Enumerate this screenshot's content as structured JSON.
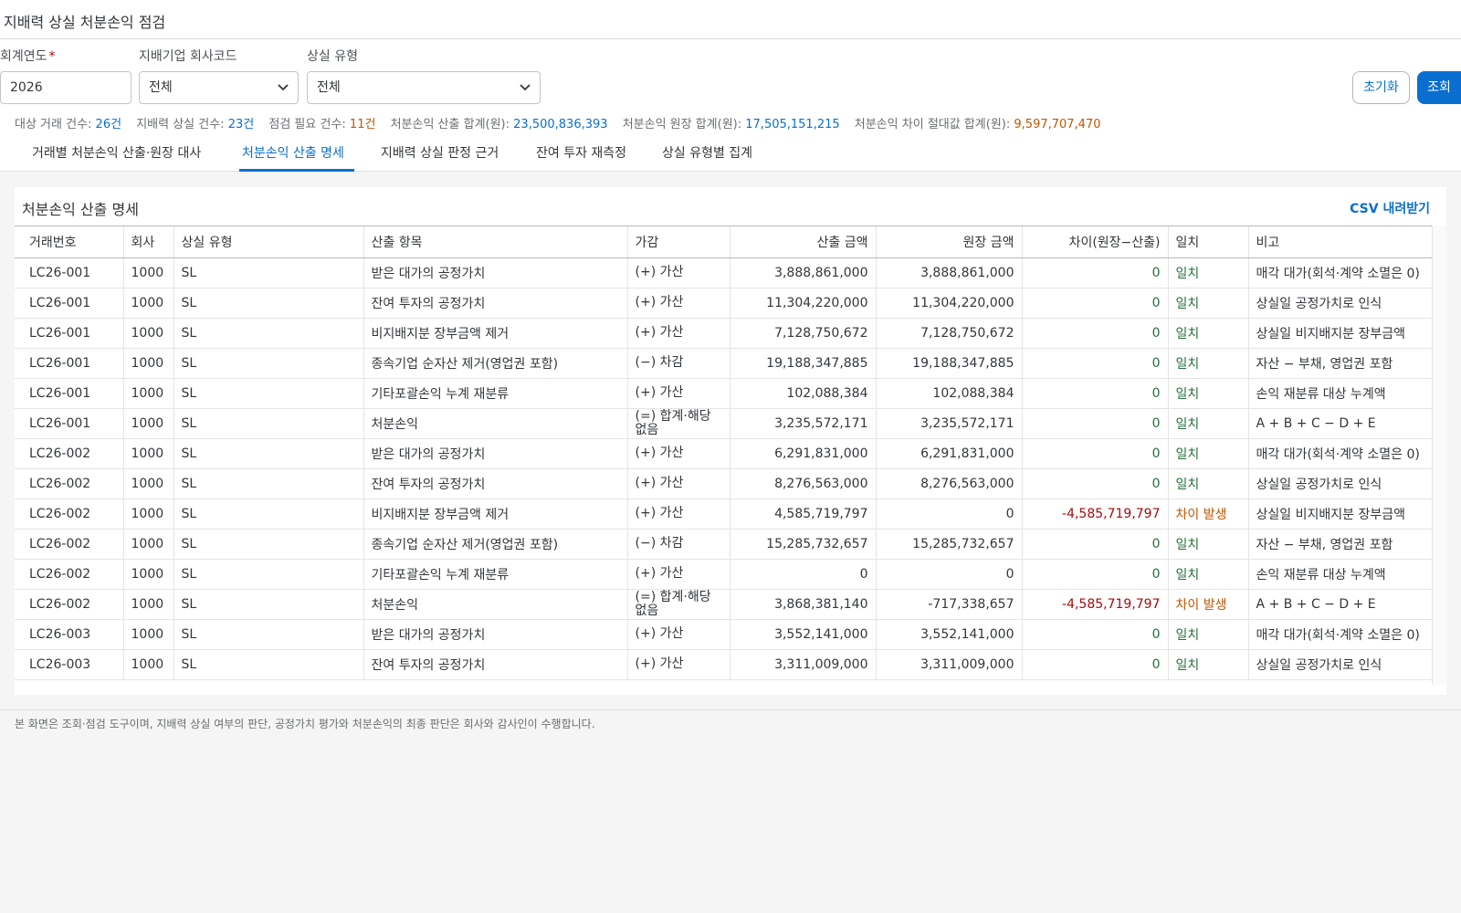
{
  "header": {
    "title": "지배력 상실 처분손익 점검"
  },
  "filters": {
    "year": {
      "label": "회계연도",
      "required_mark": "*",
      "value": "2026"
    },
    "company": {
      "label": "지배기업 회사코드",
      "value": "전체"
    },
    "loss_type": {
      "label": "상실 유형",
      "value": "전체"
    },
    "reset_label": "초기화",
    "search_label": "조회"
  },
  "summary": {
    "target_label": "대상 거래 건수:",
    "target_value": "26건",
    "loss_label": "지배력 상실 건수:",
    "loss_value": "23건",
    "check_label": "점검 필요 건수:",
    "check_value": "11건",
    "calc_label": "처분손익 산출 합계(원):",
    "calc_value": "23,500,836,393",
    "ledger_label": "처분손익 원장 합계(원):",
    "ledger_value": "17,505,151,215",
    "diff_label": "처분손익 차이 절대값 합계(원):",
    "diff_value": "9,597,707,470"
  },
  "tabs": [
    {
      "label": "거래별 처분손익 산출·원장 대사"
    },
    {
      "label": "처분손익 산출 명세"
    },
    {
      "label": "지배력 상실 판정 근거"
    },
    {
      "label": "잔여 투자 재측정"
    },
    {
      "label": "상실 유형별 집계"
    }
  ],
  "panel": {
    "title": "처분손익 산출 명세",
    "csv_label": "CSV 내려받기"
  },
  "table": {
    "columns": [
      "거래번호",
      "회사",
      "상실 유형",
      "산출 항목",
      "가감",
      "산출 금액",
      "원장 금액",
      "차이(원장−산출)",
      "일치",
      "비고"
    ],
    "rows": [
      [
        "LC26-001",
        "1000",
        "SL",
        "받은 대가의 공정가치",
        "(+) 가산",
        "3,888,861,000",
        "3,888,861,000",
        "0",
        "일치",
        "매각 대가(회석·계약 소멸은 0)"
      ],
      [
        "LC26-001",
        "1000",
        "SL",
        "잔여 투자의 공정가치",
        "(+) 가산",
        "11,304,220,000",
        "11,304,220,000",
        "0",
        "일치",
        "상실일 공정가치로 인식"
      ],
      [
        "LC26-001",
        "1000",
        "SL",
        "비지배지분 장부금액 제거",
        "(+) 가산",
        "7,128,750,672",
        "7,128,750,672",
        "0",
        "일치",
        "상실일 비지배지분 장부금액"
      ],
      [
        "LC26-001",
        "1000",
        "SL",
        "종속기업 순자산 제거(영업권 포함)",
        "(−) 차감",
        "19,188,347,885",
        "19,188,347,885",
        "0",
        "일치",
        "자산 − 부채, 영업권 포함"
      ],
      [
        "LC26-001",
        "1000",
        "SL",
        "기타포괄손익 누계 재분류",
        "(+) 가산",
        "102,088,384",
        "102,088,384",
        "0",
        "일치",
        "손익 재분류 대상 누계액"
      ],
      [
        "LC26-001",
        "1000",
        "SL",
        "처분손익",
        "(=) 합계·해당 없음",
        "3,235,572,171",
        "3,235,572,171",
        "0",
        "일치",
        "A + B + C − D + E"
      ],
      [
        "LC26-002",
        "1000",
        "SL",
        "받은 대가의 공정가치",
        "(+) 가산",
        "6,291,831,000",
        "6,291,831,000",
        "0",
        "일치",
        "매각 대가(회석·계약 소멸은 0)"
      ],
      [
        "LC26-002",
        "1000",
        "SL",
        "잔여 투자의 공정가치",
        "(+) 가산",
        "8,276,563,000",
        "8,276,563,000",
        "0",
        "일치",
        "상실일 공정가치로 인식"
      ],
      [
        "LC26-002",
        "1000",
        "SL",
        "비지배지분 장부금액 제거",
        "(+) 가산",
        "4,585,719,797",
        "0",
        "-4,585,719,797",
        "차이 발생",
        "상실일 비지배지분 장부금액"
      ],
      [
        "LC26-002",
        "1000",
        "SL",
        "종속기업 순자산 제거(영업권 포함)",
        "(−) 차감",
        "15,285,732,657",
        "15,285,732,657",
        "0",
        "일치",
        "자산 − 부채, 영업권 포함"
      ],
      [
        "LC26-002",
        "1000",
        "SL",
        "기타포괄손익 누계 재분류",
        "(+) 가산",
        "0",
        "0",
        "0",
        "일치",
        "손익 재분류 대상 누계액"
      ],
      [
        "LC26-002",
        "1000",
        "SL",
        "처분손익",
        "(=) 합계·해당 없음",
        "3,868,381,140",
        "-717,338,657",
        "-4,585,719,797",
        "차이 발생",
        "A + B + C − D + E"
      ],
      [
        "LC26-003",
        "1000",
        "SL",
        "받은 대가의 공정가치",
        "(+) 가산",
        "3,552,141,000",
        "3,552,141,000",
        "0",
        "일치",
        "매각 대가(회석·계약 소멸은 0)"
      ],
      [
        "LC26-003",
        "1000",
        "SL",
        "잔여 투자의 공정가치",
        "(+) 가산",
        "3,311,009,000",
        "3,311,009,000",
        "0",
        "일치",
        "상실일 공정가치로 인식"
      ]
    ]
  },
  "footer": {
    "note": "본 화면은 조회·점검 도구이며, 지배력 상실 여부의 판단, 공정가치 평가와 처분손익의 최종 판단은 회사와 감사인이 수행합니다."
  }
}
